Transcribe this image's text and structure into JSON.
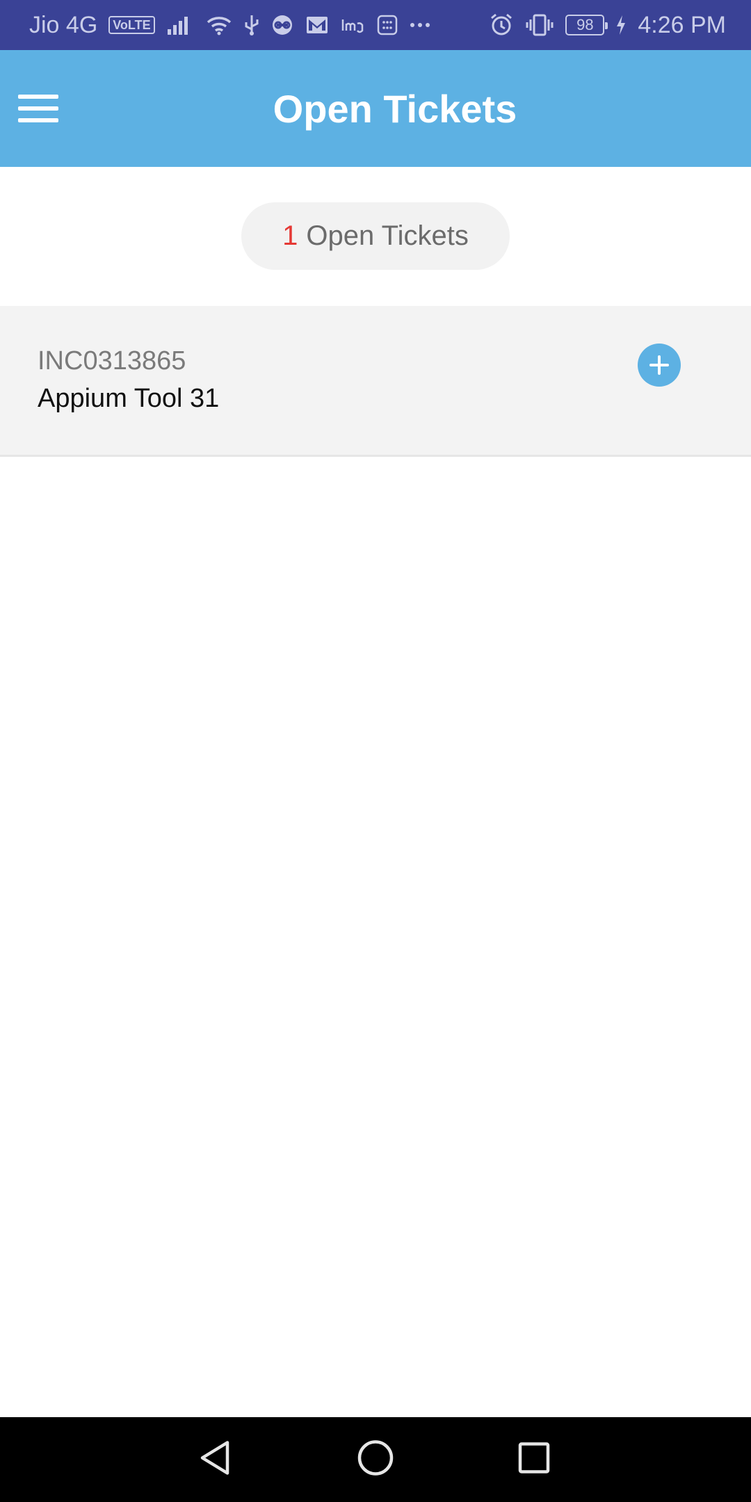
{
  "status_bar": {
    "carrier": "Jio 4G",
    "volte": "VoLTE",
    "battery": "98",
    "time": "4:26 PM",
    "background_color": "#3a4296",
    "icons": [
      "signal-icon",
      "wifi-icon",
      "usb-icon",
      "link-icon",
      "gmail-icon",
      "1mg-icon",
      "app-icon",
      "more-icon",
      "alarm-icon",
      "vibrate-icon",
      "battery-icon",
      "charging-icon"
    ]
  },
  "app_bar": {
    "title": "Open Tickets",
    "menu_icon": "hamburger-menu-icon",
    "background_color": "#5db1e3"
  },
  "summary": {
    "count": "1",
    "label": "Open Tickets",
    "count_color": "#e53935"
  },
  "tickets": [
    {
      "id": "INC0313865",
      "title": "Appium Tool 31",
      "action_icon": "plus-icon"
    }
  ],
  "nav_bar": {
    "back_icon": "back-icon",
    "home_icon": "home-icon",
    "recents_icon": "recents-icon"
  }
}
